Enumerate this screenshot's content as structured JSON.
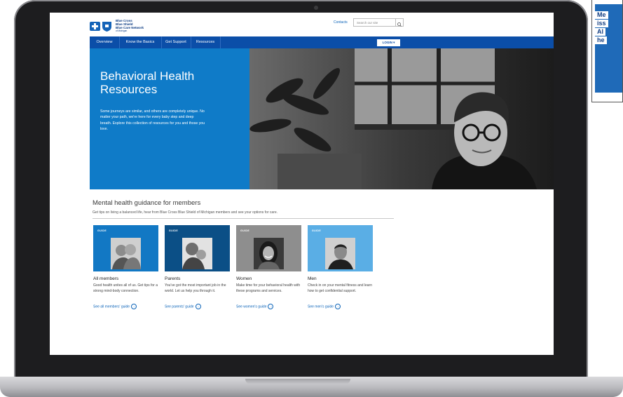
{
  "header": {
    "logo_lines": [
      "Blue Cross",
      "Blue Shield",
      "Blue Care Network",
      "of Michigan"
    ],
    "contacts": "Contacts",
    "search_placeholder": "Search our site",
    "login": "LOGIN"
  },
  "nav": {
    "items": [
      "Overview",
      "Know the Basics",
      "Get Support",
      "Resources"
    ]
  },
  "hero": {
    "title_line1": "Behavioral Health",
    "title_line2": "Resources",
    "body": "Some journeys are similar, and others are completely unique. No matter your path, we're here for every baby step and deep breath. Explore this collection of resources for you and those you love."
  },
  "guidance": {
    "title": "Mental health guidance for members",
    "subtitle": "Get tips on living a balanced life, hear from Blue Cross Blue Shield of Michigan members and see your options for care.",
    "cards": [
      {
        "guide": "GUIDE",
        "title": "All members",
        "desc": "Good health unites all of us. Get tips for a strong mind-body connection.",
        "link": "See all members' guide",
        "color": "#1278c4"
      },
      {
        "guide": "GUIDE",
        "title": "Parents",
        "desc": "You've got the most important job in the world. Let us help you through it.",
        "link": "See parents' guide",
        "color": "#0b4f86"
      },
      {
        "guide": "GUIDE",
        "title": "Women",
        "desc": "Make time for your behavioral health with these programs and services.",
        "link": "See women's guide",
        "color": "#8e8e8e"
      },
      {
        "guide": "GUIDE",
        "title": "Men",
        "desc": "Check in on your mental fitness and learn how to get confidential support.",
        "link": "See men's guide",
        "color": "#5aaee5"
      }
    ]
  },
  "side_panel": {
    "words": [
      "Me",
      "iss",
      "Al",
      "he"
    ]
  },
  "colors": {
    "brand_blue": "#0b4ea8",
    "hero_blue": "#0f7bc8",
    "link_blue": "#0b63b8"
  }
}
